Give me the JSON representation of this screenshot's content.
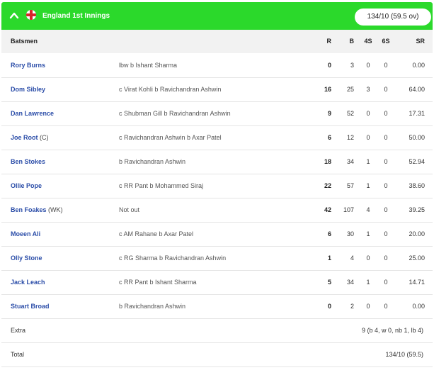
{
  "header": {
    "title": "England 1st Innings",
    "score": "134/10 (59.5 ov)"
  },
  "columns": {
    "batsmen": "Batsmen",
    "r": "R",
    "b": "B",
    "fours": "4S",
    "sixes": "6S",
    "sr": "SR"
  },
  "batsmen": [
    {
      "name": "Rory Burns",
      "role": "",
      "dismissal": "lbw b Ishant Sharma",
      "r": "0",
      "b": "3",
      "fours": "0",
      "sixes": "0",
      "sr": "0.00"
    },
    {
      "name": "Dom Sibley",
      "role": "",
      "dismissal": "c Virat Kohli b Ravichandran Ashwin",
      "r": "16",
      "b": "25",
      "fours": "3",
      "sixes": "0",
      "sr": "64.00"
    },
    {
      "name": "Dan Lawrence",
      "role": "",
      "dismissal": "c Shubman Gill b Ravichandran Ashwin",
      "r": "9",
      "b": "52",
      "fours": "0",
      "sixes": "0",
      "sr": "17.31"
    },
    {
      "name": "Joe Root",
      "role": "(C)",
      "dismissal": "c Ravichandran Ashwin b Axar Patel",
      "r": "6",
      "b": "12",
      "fours": "0",
      "sixes": "0",
      "sr": "50.00"
    },
    {
      "name": "Ben Stokes",
      "role": "",
      "dismissal": "b Ravichandran Ashwin",
      "r": "18",
      "b": "34",
      "fours": "1",
      "sixes": "0",
      "sr": "52.94"
    },
    {
      "name": "Ollie Pope",
      "role": "",
      "dismissal": "c RR Pant b Mohammed Siraj",
      "r": "22",
      "b": "57",
      "fours": "1",
      "sixes": "0",
      "sr": "38.60"
    },
    {
      "name": "Ben Foakes",
      "role": "(WK)",
      "dismissal": "Not out",
      "r": "42",
      "b": "107",
      "fours": "4",
      "sixes": "0",
      "sr": "39.25"
    },
    {
      "name": "Moeen Ali",
      "role": "",
      "dismissal": "c AM Rahane b Axar Patel",
      "r": "6",
      "b": "30",
      "fours": "1",
      "sixes": "0",
      "sr": "20.00"
    },
    {
      "name": "Olly Stone",
      "role": "",
      "dismissal": "c RG Sharma b Ravichandran Ashwin",
      "r": "1",
      "b": "4",
      "fours": "0",
      "sixes": "0",
      "sr": "25.00"
    },
    {
      "name": "Jack Leach",
      "role": "",
      "dismissal": "c RR Pant b Ishant Sharma",
      "r": "5",
      "b": "34",
      "fours": "1",
      "sixes": "0",
      "sr": "14.71"
    },
    {
      "name": "Stuart Broad",
      "role": "",
      "dismissal": "b Ravichandran Ashwin",
      "r": "0",
      "b": "2",
      "fours": "0",
      "sixes": "0",
      "sr": "0.00"
    }
  ],
  "extra": {
    "label": "Extra",
    "value": "9 (b 4, w 0, nb 1, lb 4)"
  },
  "total": {
    "label": "Total",
    "value": "134/10 (59.5)"
  },
  "colors": {
    "header_bg": "#2bd92b",
    "name_link": "#2b4da8",
    "subheader_bg": "#f2f2f2"
  },
  "icons": {
    "toggle": "chevron-up-icon",
    "team": "england-flag-icon"
  }
}
